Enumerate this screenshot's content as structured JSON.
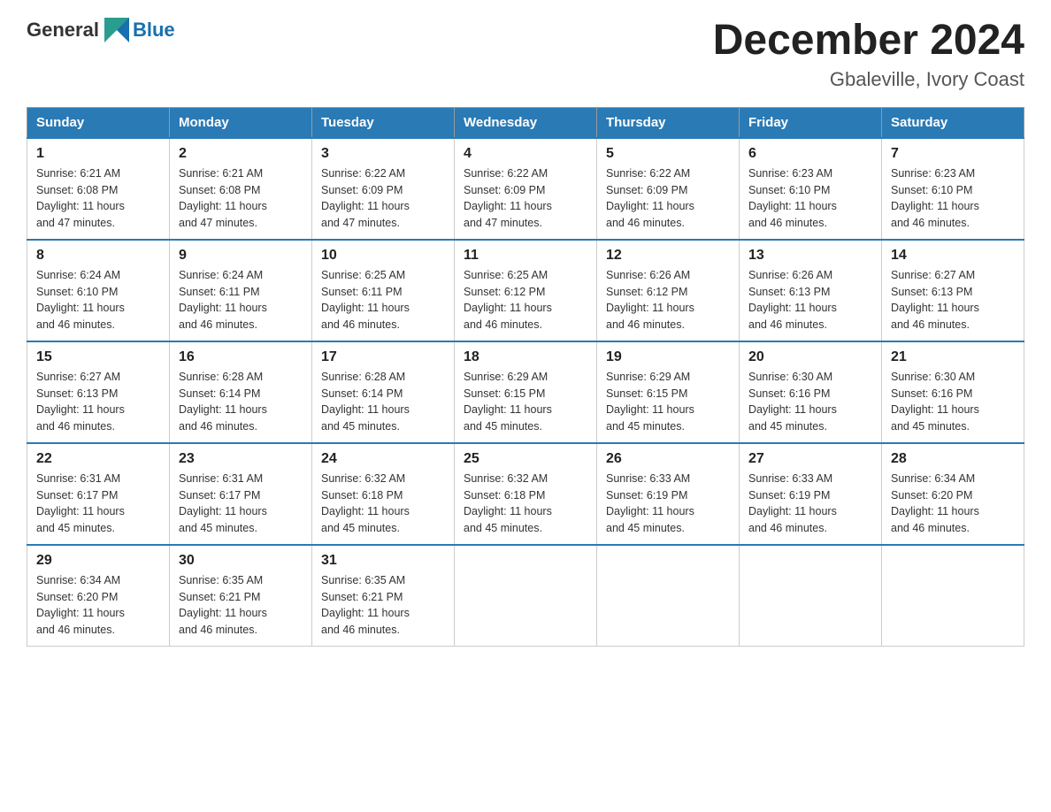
{
  "header": {
    "logo_general": "General",
    "logo_blue": "Blue",
    "title": "December 2024",
    "location": "Gbaleville, Ivory Coast"
  },
  "days_of_week": [
    "Sunday",
    "Monday",
    "Tuesday",
    "Wednesday",
    "Thursday",
    "Friday",
    "Saturday"
  ],
  "weeks": [
    [
      {
        "day": "1",
        "sunrise": "6:21 AM",
        "sunset": "6:08 PM",
        "daylight": "11 hours and 47 minutes."
      },
      {
        "day": "2",
        "sunrise": "6:21 AM",
        "sunset": "6:08 PM",
        "daylight": "11 hours and 47 minutes."
      },
      {
        "day": "3",
        "sunrise": "6:22 AM",
        "sunset": "6:09 PM",
        "daylight": "11 hours and 47 minutes."
      },
      {
        "day": "4",
        "sunrise": "6:22 AM",
        "sunset": "6:09 PM",
        "daylight": "11 hours and 47 minutes."
      },
      {
        "day": "5",
        "sunrise": "6:22 AM",
        "sunset": "6:09 PM",
        "daylight": "11 hours and 46 minutes."
      },
      {
        "day": "6",
        "sunrise": "6:23 AM",
        "sunset": "6:10 PM",
        "daylight": "11 hours and 46 minutes."
      },
      {
        "day": "7",
        "sunrise": "6:23 AM",
        "sunset": "6:10 PM",
        "daylight": "11 hours and 46 minutes."
      }
    ],
    [
      {
        "day": "8",
        "sunrise": "6:24 AM",
        "sunset": "6:10 PM",
        "daylight": "11 hours and 46 minutes."
      },
      {
        "day": "9",
        "sunrise": "6:24 AM",
        "sunset": "6:11 PM",
        "daylight": "11 hours and 46 minutes."
      },
      {
        "day": "10",
        "sunrise": "6:25 AM",
        "sunset": "6:11 PM",
        "daylight": "11 hours and 46 minutes."
      },
      {
        "day": "11",
        "sunrise": "6:25 AM",
        "sunset": "6:12 PM",
        "daylight": "11 hours and 46 minutes."
      },
      {
        "day": "12",
        "sunrise": "6:26 AM",
        "sunset": "6:12 PM",
        "daylight": "11 hours and 46 minutes."
      },
      {
        "day": "13",
        "sunrise": "6:26 AM",
        "sunset": "6:13 PM",
        "daylight": "11 hours and 46 minutes."
      },
      {
        "day": "14",
        "sunrise": "6:27 AM",
        "sunset": "6:13 PM",
        "daylight": "11 hours and 46 minutes."
      }
    ],
    [
      {
        "day": "15",
        "sunrise": "6:27 AM",
        "sunset": "6:13 PM",
        "daylight": "11 hours and 46 minutes."
      },
      {
        "day": "16",
        "sunrise": "6:28 AM",
        "sunset": "6:14 PM",
        "daylight": "11 hours and 46 minutes."
      },
      {
        "day": "17",
        "sunrise": "6:28 AM",
        "sunset": "6:14 PM",
        "daylight": "11 hours and 45 minutes."
      },
      {
        "day": "18",
        "sunrise": "6:29 AM",
        "sunset": "6:15 PM",
        "daylight": "11 hours and 45 minutes."
      },
      {
        "day": "19",
        "sunrise": "6:29 AM",
        "sunset": "6:15 PM",
        "daylight": "11 hours and 45 minutes."
      },
      {
        "day": "20",
        "sunrise": "6:30 AM",
        "sunset": "6:16 PM",
        "daylight": "11 hours and 45 minutes."
      },
      {
        "day": "21",
        "sunrise": "6:30 AM",
        "sunset": "6:16 PM",
        "daylight": "11 hours and 45 minutes."
      }
    ],
    [
      {
        "day": "22",
        "sunrise": "6:31 AM",
        "sunset": "6:17 PM",
        "daylight": "11 hours and 45 minutes."
      },
      {
        "day": "23",
        "sunrise": "6:31 AM",
        "sunset": "6:17 PM",
        "daylight": "11 hours and 45 minutes."
      },
      {
        "day": "24",
        "sunrise": "6:32 AM",
        "sunset": "6:18 PM",
        "daylight": "11 hours and 45 minutes."
      },
      {
        "day": "25",
        "sunrise": "6:32 AM",
        "sunset": "6:18 PM",
        "daylight": "11 hours and 45 minutes."
      },
      {
        "day": "26",
        "sunrise": "6:33 AM",
        "sunset": "6:19 PM",
        "daylight": "11 hours and 45 minutes."
      },
      {
        "day": "27",
        "sunrise": "6:33 AM",
        "sunset": "6:19 PM",
        "daylight": "11 hours and 46 minutes."
      },
      {
        "day": "28",
        "sunrise": "6:34 AM",
        "sunset": "6:20 PM",
        "daylight": "11 hours and 46 minutes."
      }
    ],
    [
      {
        "day": "29",
        "sunrise": "6:34 AM",
        "sunset": "6:20 PM",
        "daylight": "11 hours and 46 minutes."
      },
      {
        "day": "30",
        "sunrise": "6:35 AM",
        "sunset": "6:21 PM",
        "daylight": "11 hours and 46 minutes."
      },
      {
        "day": "31",
        "sunrise": "6:35 AM",
        "sunset": "6:21 PM",
        "daylight": "11 hours and 46 minutes."
      },
      null,
      null,
      null,
      null
    ]
  ],
  "labels": {
    "sunrise": "Sunrise:",
    "sunset": "Sunset:",
    "daylight": "Daylight:"
  }
}
